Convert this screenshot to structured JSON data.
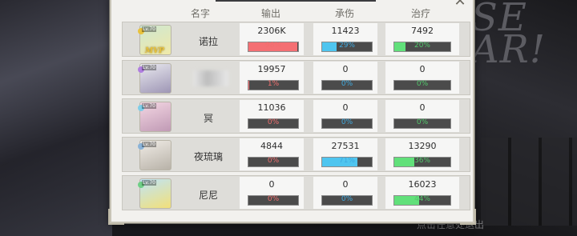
{
  "header": {
    "name": "名字",
    "damage_out": "输出",
    "damage_taken": "承伤",
    "healing": "治疗"
  },
  "background": {
    "title_fragment": "SE\nAR!",
    "exit_hint": "点击任意处退出"
  },
  "close_glyph": "✕",
  "rows": [
    {
      "name": "诺拉",
      "level": "Lv.70",
      "mvp": true,
      "mvp_text": "MVP",
      "out": "2306K",
      "out_pct": 98,
      "out_label": "98%",
      "tank": "11423",
      "tank_pct": 29,
      "tank_label": "29%",
      "heal": "7492",
      "heal_pct": 20,
      "heal_label": "20%",
      "portrait_colors": [
        "#cfe7d1",
        "#f0e9a8"
      ],
      "element_color": "#e8c23c"
    },
    {
      "name": "",
      "blurred": true,
      "level": "Lv.70",
      "mvp": false,
      "out": "19957",
      "out_pct": 1,
      "out_label": "1%",
      "tank": "0",
      "tank_pct": 0,
      "tank_label": "0%",
      "heal": "0",
      "heal_pct": 0,
      "heal_label": "0%",
      "portrait_colors": [
        "#e9e9ef",
        "#9e96b5"
      ],
      "element_color": "#b07ee0"
    },
    {
      "name": "冥",
      "level": "Lv.70",
      "mvp": false,
      "out": "11036",
      "out_pct": 0,
      "out_label": "0%",
      "tank": "0",
      "tank_pct": 0,
      "tank_label": "0%",
      "heal": "0",
      "heal_pct": 0,
      "heal_label": "0%",
      "portrait_colors": [
        "#f4d7e3",
        "#c09ab5"
      ],
      "element_color": "#7ecde8"
    },
    {
      "name": "夜琉璃",
      "level": "Lv.70",
      "mvp": false,
      "out": "4844",
      "out_pct": 0,
      "out_label": "0%",
      "tank": "27531",
      "tank_pct": 71,
      "tank_label": "71%",
      "heal": "13290",
      "heal_pct": 36,
      "heal_label": "36%",
      "portrait_colors": [
        "#f0ece6",
        "#b8b2a8"
      ],
      "element_color": "#8ab3d8"
    },
    {
      "name": "尼尼",
      "level": "Lv.70",
      "mvp": false,
      "out": "0",
      "out_pct": 0,
      "out_label": "0%",
      "tank": "0",
      "tank_pct": 0,
      "tank_label": "0%",
      "heal": "16023",
      "heal_pct": 44,
      "heal_label": "44%",
      "portrait_colors": [
        "#bfe4f6",
        "#f2e07a"
      ],
      "element_color": "#6fcf87"
    }
  ]
}
